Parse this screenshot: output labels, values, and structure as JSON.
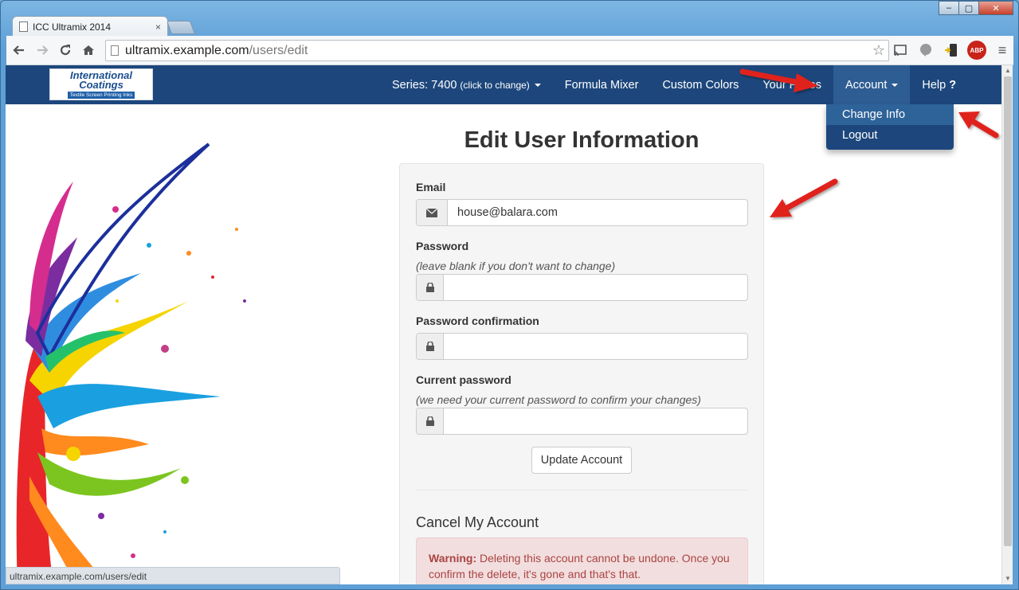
{
  "browser": {
    "tab_title": "ICC Ultramix 2014",
    "tab_close": "×",
    "url_host": "ultramix.example.com",
    "url_path": "/users/edit",
    "status_url": "ultramix.example.com/users/edit",
    "win_minimize": "–",
    "win_maximize": "▢",
    "win_close": "✕"
  },
  "logo": {
    "line1": "International",
    "line2": "Coatings",
    "tagline": "Textile Screen Printing Inks"
  },
  "navbar": {
    "series_label": "Series: 7400",
    "series_hint": "(click to change)",
    "formula_mixer": "Formula Mixer",
    "custom_colors": "Custom Colors",
    "your_prices": "Your Prices",
    "account": "Account",
    "help": "Help",
    "help_mark": "?"
  },
  "account_menu": {
    "change_info": "Change Info",
    "logout": "Logout"
  },
  "form": {
    "heading": "Edit User Information",
    "email_label": "Email",
    "email_value": "house@balara.com",
    "password_label": "Password",
    "password_help": "(leave blank if you don't want to change)",
    "password_confirmation_label": "Password confirmation",
    "current_password_label": "Current password",
    "current_password_help": "(we need your current password to confirm your changes)",
    "update_button": "Update Account"
  },
  "cancel": {
    "heading": "Cancel My Account",
    "warning_strong": "Warning:",
    "warning_text": " Deleting this account cannot be undone. Once you confirm the delete, it's gone and that's that."
  },
  "colors": {
    "navbar_bg": "#1d477c",
    "navbar_active": "#2e5d94",
    "alert_bg": "#f2dede",
    "alert_text": "#a94442",
    "annotation_arrow": "#e0201b"
  }
}
